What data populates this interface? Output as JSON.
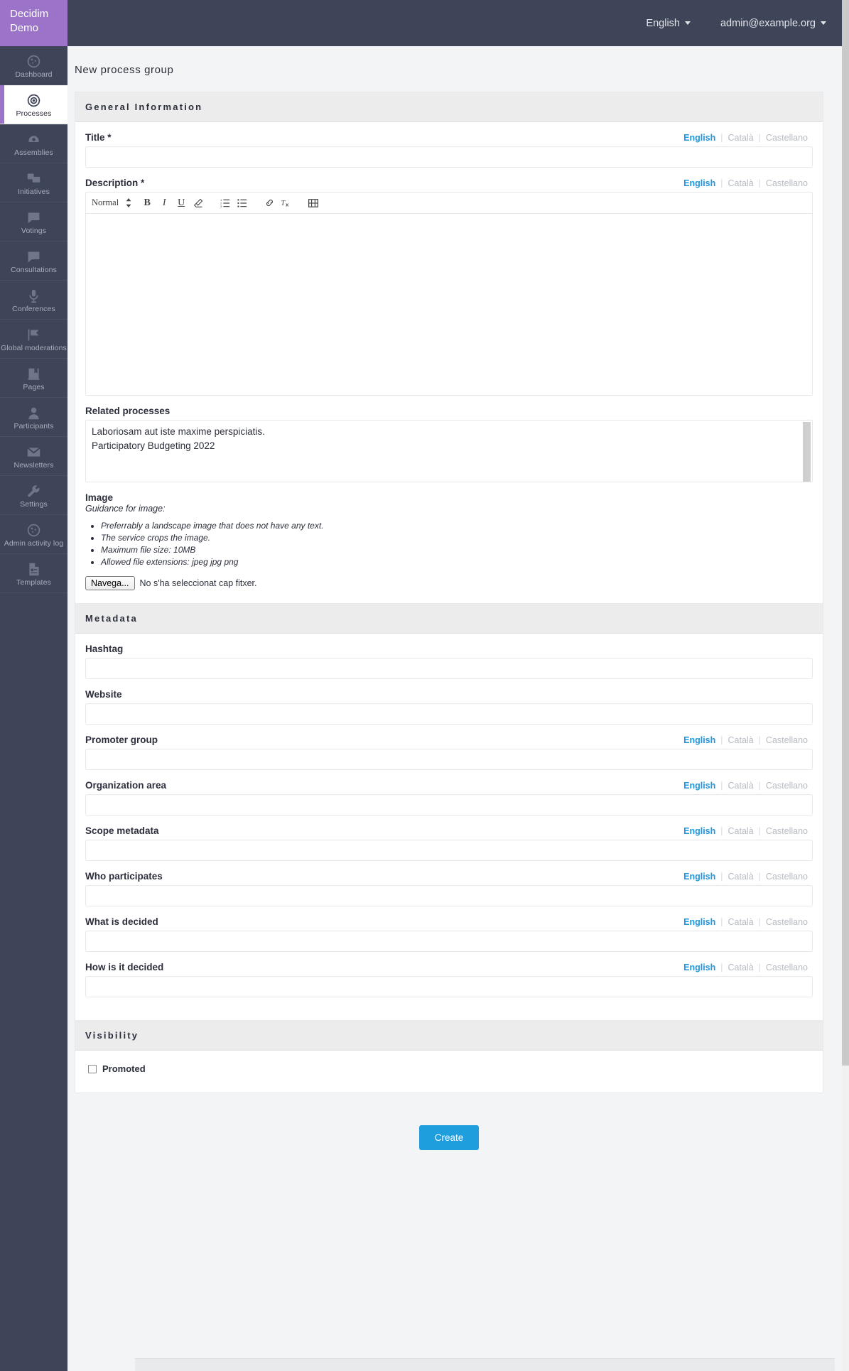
{
  "brand": {
    "line1": "Decidim",
    "line2": "Demo"
  },
  "topbar": {
    "language": "English",
    "account": "admin@example.org"
  },
  "sidebar": {
    "items": [
      {
        "label": "Dashboard",
        "icon": "dashboard-icon",
        "active": false
      },
      {
        "label": "Processes",
        "icon": "target-icon",
        "active": true
      },
      {
        "label": "Assemblies",
        "icon": "assemblies-icon",
        "active": false
      },
      {
        "label": "Initiatives",
        "icon": "initiatives-icon",
        "active": false
      },
      {
        "label": "Votings",
        "icon": "votings-icon",
        "active": false
      },
      {
        "label": "Consultations",
        "icon": "consultations-icon",
        "active": false
      },
      {
        "label": "Conferences",
        "icon": "microphone-icon",
        "active": false
      },
      {
        "label": "Global moderations",
        "icon": "flag-icon",
        "active": false
      },
      {
        "label": "Pages",
        "icon": "book-icon",
        "active": false
      },
      {
        "label": "Participants",
        "icon": "user-icon",
        "active": false
      },
      {
        "label": "Newsletters",
        "icon": "envelope-icon",
        "active": false
      },
      {
        "label": "Settings",
        "icon": "wrench-icon",
        "active": false
      },
      {
        "label": "Admin activity log",
        "icon": "activity-log-icon",
        "active": false
      },
      {
        "label": "Templates",
        "icon": "templates-icon",
        "active": false
      }
    ]
  },
  "page": {
    "title": "New process group"
  },
  "languages": {
    "selected": "English",
    "others": [
      "Català",
      "Castellano"
    ]
  },
  "general": {
    "heading": "General Information",
    "title_label": "Title *",
    "title_value": "",
    "description_label": "Description *",
    "description_value": "",
    "toolbar": {
      "format": "Normal",
      "bold": "B",
      "italic": "I",
      "underline": "U"
    },
    "related_label": "Related processes",
    "related_options": [
      "Laboriosam aut iste maxime perspiciatis.",
      "Participatory Budgeting 2022"
    ],
    "image_label": "Image",
    "image_guidance_title": "Guidance for image:",
    "image_guidance": [
      "Preferrably a landscape image that does not have any text.",
      "The service crops the image.",
      "Maximum file size: 10MB",
      "Allowed file extensions: jpeg jpg png"
    ],
    "file_button": "Navega...",
    "file_status": "No s'ha seleccionat cap fitxer."
  },
  "metadata": {
    "heading": "Metadata",
    "fields": [
      {
        "label": "Hashtag",
        "value": "",
        "localized": false
      },
      {
        "label": "Website",
        "value": "",
        "localized": false
      },
      {
        "label": "Promoter group",
        "value": "",
        "localized": true
      },
      {
        "label": "Organization area",
        "value": "",
        "localized": true
      },
      {
        "label": "Scope metadata",
        "value": "",
        "localized": true
      },
      {
        "label": "Who participates",
        "value": "",
        "localized": true
      },
      {
        "label": "What is decided",
        "value": "",
        "localized": true
      },
      {
        "label": "How is it decided",
        "value": "",
        "localized": true
      }
    ]
  },
  "visibility": {
    "heading": "Visibility",
    "promoted_label": "Promoted",
    "promoted_checked": false
  },
  "actions": {
    "create": "Create"
  },
  "colors": {
    "brand_purple": "#9b74c9",
    "sidebar": "#3e4558",
    "accent_blue": "#2196e1",
    "button_blue": "#1f9ede"
  }
}
